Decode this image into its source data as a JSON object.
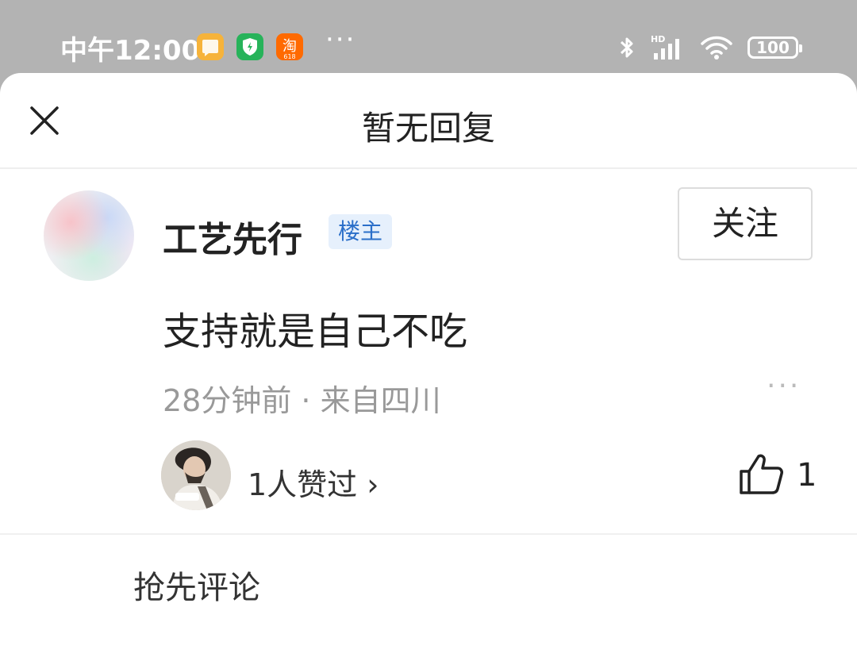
{
  "status_bar": {
    "time": "中午12:00",
    "app_icons": [
      "notes-icon",
      "shield-icon",
      "taobao-icon"
    ],
    "overflow": "···",
    "battery": "100"
  },
  "sheet": {
    "title": "暂无回复",
    "comment": {
      "username": "工艺先行",
      "badge": "楼主",
      "follow_label": "关注",
      "text": "支持就是自己不吃",
      "meta": "28分钟前 · 来自四川",
      "more": "···",
      "likes_summary": "1人赞过 ›",
      "like_count": "1"
    },
    "comment_placeholder": "抢先评论"
  },
  "colors": {
    "badge_bg": "#e6f0fc",
    "badge_text": "#2b6fc9",
    "meta_text": "#999999"
  }
}
